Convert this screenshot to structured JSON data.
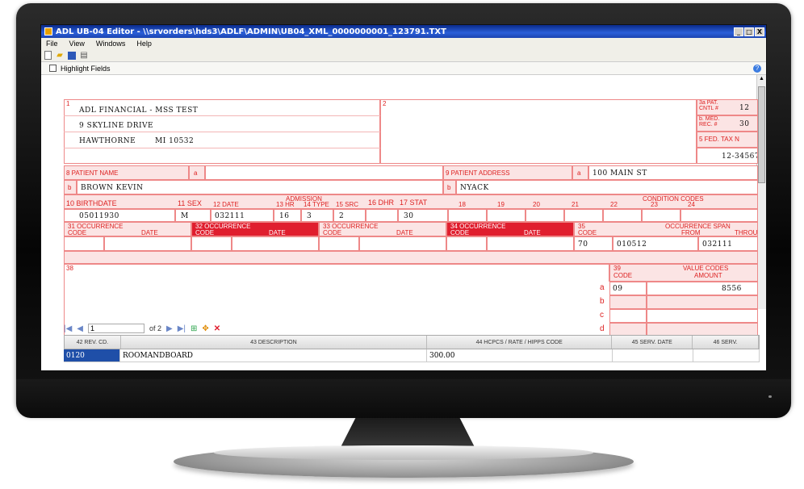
{
  "window": {
    "title": "ADL UB-04 Editor - \\\\srvorders\\hds3\\ADLF\\ADMIN\\UB04_XML_0000000001_123791.TXT",
    "buttons": [
      "_",
      "□",
      "X"
    ]
  },
  "menu": [
    "File",
    "View",
    "Windows",
    "Help"
  ],
  "toolbar": {
    "icons": [
      "new-icon",
      "open-icon",
      "save-icon",
      "print-icon"
    ]
  },
  "highlight": {
    "label": "Highlight Fields",
    "checked": false
  },
  "form": {
    "box1_num": "1",
    "box2_num": "2",
    "provider_line1": "ADL FINANCIAL - MSS TEST",
    "provider_line2": "9 SKYLINE DRIVE",
    "provider_city": "HAWTHORNE",
    "provider_state_zip": "MI 10532",
    "pat_cntl_label": "3a PAT. CNTL #",
    "pat_cntl_value": "12",
    "med_rec_label": "b. MED. REC. #",
    "med_rec_value": "30",
    "fed_tax_label": "5 FED. TAX N",
    "fed_tax_value": "12-34567",
    "patient_name_label": "8 PATIENT NAME",
    "a_label": "a",
    "b_label": "b",
    "patient_name_value": "BROWN KEVIN",
    "patient_address_label": "9 PATIENT ADDRESS",
    "patient_address_line": "100 MAIN ST",
    "patient_city": "NYACK",
    "birthdate_label": "10 BIRTHDATE",
    "sex_label": "11 SEX",
    "admission_label": "ADMISSION",
    "date_label": "12    DATE",
    "hr_label": "13 HR",
    "type_label": "14 TYPE",
    "src_label": "15 SRC",
    "dhr_label": "16 DHR",
    "stat_label": "17 STAT",
    "cond_label": "CONDITION CODES",
    "cond_nums": [
      "18",
      "19",
      "20",
      "21",
      "22",
      "23",
      "24"
    ],
    "birthdate_value": "05011930",
    "sex_value": "M",
    "adm_date_value": "032111",
    "adm_hr_value": "16",
    "adm_type_value": "3",
    "adm_src_value": "2",
    "stat_value": "30",
    "occ31": "31    OCCURRENCE",
    "occ32": "32    OCCURRENCE",
    "occ33": "33    OCCURRENCE",
    "occ34": "34    OCCURRENCE",
    "occ35": "35",
    "code_label": "CODE",
    "date_col_label": "DATE",
    "occ_span_label": "OCCURRENCE SPAN",
    "from_label": "FROM",
    "through_label": "THROU",
    "span_code_value": "70",
    "span_from_value": "010512",
    "span_through_value": "032111",
    "box38": "38",
    "value_codes_label": "VALUE CODES",
    "box39": "39",
    "amount_label": "AMOUNT",
    "value_code_a": "09",
    "value_amount_a": "8556",
    "row_letters": [
      "a",
      "b",
      "c",
      "d"
    ]
  },
  "navigator": {
    "first": "|◀",
    "prev": "◀",
    "page": "1",
    "of": "of 2",
    "next": "▶",
    "last": "▶|",
    "add": "⊞",
    "move": "✥",
    "delete": "✕"
  },
  "grid": {
    "columns": [
      "42 REV. CD.",
      "43 DESCRIPTION",
      "44 HCPCS / RATE / HIPPS CODE",
      "45 SERV. DATE",
      "46 SERV."
    ],
    "rows": [
      {
        "rev": "0120",
        "description": "ROOMANDBOARD",
        "hcpcs": "300.00",
        "date": "",
        "serv": ""
      }
    ]
  }
}
